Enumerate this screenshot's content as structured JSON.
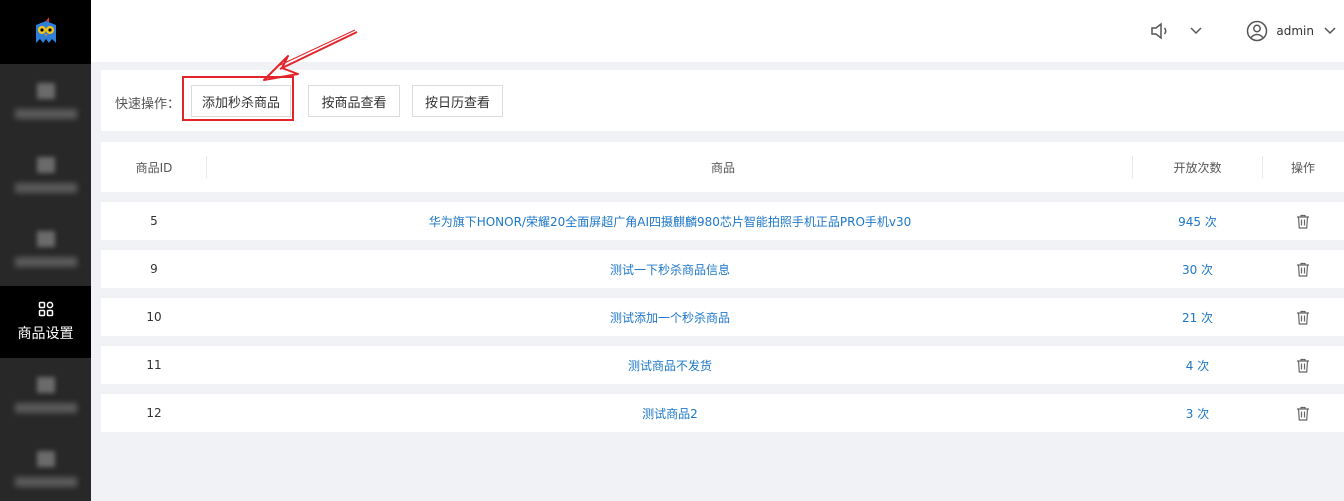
{
  "sidebar": {
    "active_item": {
      "label": "商品设置",
      "icon": "grid-icon"
    }
  },
  "header": {
    "username": "admin"
  },
  "quick_actions": {
    "label": "快速操作：",
    "buttons": [
      "添加秒杀商品",
      "按商品查看",
      "按日历查看"
    ]
  },
  "table": {
    "headers": {
      "id": "商品ID",
      "product": "商品",
      "opens": "开放次数",
      "ops": "操作"
    },
    "rows": [
      {
        "id": "5",
        "product": "华为旗下HONOR/荣耀20全面屏超广角AI四摄麒麟980芯片智能拍照手机正品PRO手机v30",
        "opens": "945 次"
      },
      {
        "id": "9",
        "product": "测试一下秒杀商品信息",
        "opens": "30 次"
      },
      {
        "id": "10",
        "product": "测试添加一个秒杀商品",
        "opens": "21 次"
      },
      {
        "id": "11",
        "product": "测试商品不发货",
        "opens": "4 次"
      },
      {
        "id": "12",
        "product": "测试商品2",
        "opens": "3 次"
      }
    ]
  },
  "colors": {
    "link": "#1d77c9",
    "highlight": "#e3252b",
    "sidebar": "#282828"
  }
}
